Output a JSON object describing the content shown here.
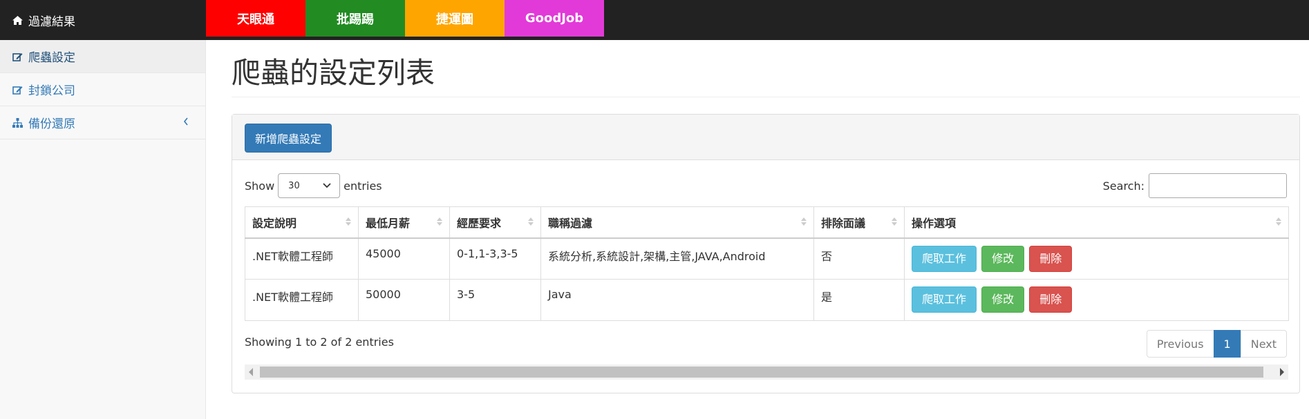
{
  "navbar": {
    "brand": "過濾結果",
    "links": [
      {
        "label": "天眼通",
        "color": "#ff0000"
      },
      {
        "label": "批踢踢",
        "color": "#228b22"
      },
      {
        "label": "捷運圖",
        "color": "#ffa500"
      },
      {
        "label": "GoodJob",
        "color": "#e23ad8"
      }
    ]
  },
  "sidebar": {
    "items": [
      {
        "label": "爬蟲設定",
        "icon": "edit-icon"
      },
      {
        "label": "封鎖公司",
        "icon": "edit-icon"
      },
      {
        "label": "備份還原",
        "icon": "sitemap-icon"
      }
    ]
  },
  "main": {
    "title": "爬蟲的設定列表",
    "new_button": "新增爬蟲設定"
  },
  "table_controls": {
    "show_label": "Show",
    "page_size": "30",
    "entries_label": "entries",
    "search_label": "Search:",
    "search_value": ""
  },
  "table": {
    "columns": [
      "設定說明",
      "最低月薪",
      "經歷要求",
      "職稱過濾",
      "排除面議",
      "操作選項"
    ],
    "rows": [
      {
        "desc": ".NET軟體工程師",
        "salary": "45000",
        "exp": "0-1,1-3,3-5",
        "titles": "系統分析,系統設計,架構,主管,JAVA,Android",
        "exclude": "否"
      },
      {
        "desc": ".NET軟體工程師",
        "salary": "50000",
        "exp": "3-5",
        "titles": "Java",
        "exclude": "是"
      }
    ],
    "actions": {
      "crawl": "爬取工作",
      "edit": "修改",
      "delete": "刪除"
    }
  },
  "footer": {
    "info": "Showing 1 to 2 of 2 entries",
    "previous": "Previous",
    "page": "1",
    "next": "Next"
  }
}
